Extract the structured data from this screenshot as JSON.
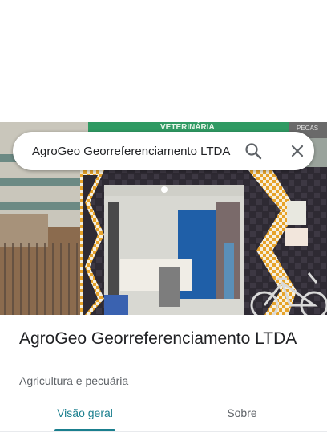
{
  "search": {
    "query": "AgroGeo Georreferenciamento LTDA",
    "search_icon": "search-icon",
    "close_icon": "close-icon"
  },
  "photo": {
    "sign_text": "VETERINÁRIA",
    "side_sign_text": "PECAS"
  },
  "place": {
    "title": "AgroGeo Georreferenciamento LTDA",
    "category": "Agricultura e pecuária"
  },
  "tabs": [
    {
      "label": "Visão geral",
      "selected": true
    },
    {
      "label": "Sobre",
      "selected": false
    }
  ],
  "colors": {
    "accent": "#1a7f8e",
    "text_primary": "#202124",
    "text_secondary": "#5f6368"
  }
}
